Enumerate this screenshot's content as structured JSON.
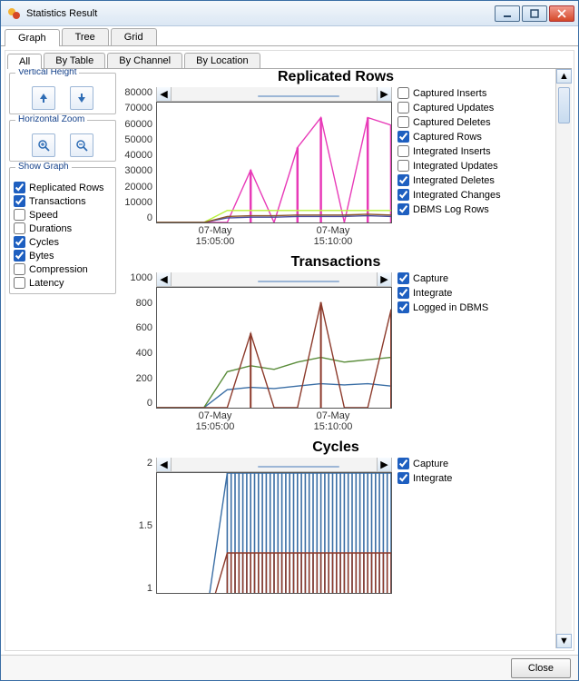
{
  "window": {
    "title": "Statistics Result"
  },
  "tabs": {
    "main": [
      "Graph",
      "Tree",
      "Grid"
    ],
    "sub": [
      "All",
      "By Table",
      "By Channel",
      "By Location"
    ]
  },
  "sidebar": {
    "vh_title": "Vertical Height",
    "hz_title": "Horizontal Zoom",
    "sg_title": "Show Graph",
    "show_items": [
      {
        "label": "Replicated Rows",
        "checked": true
      },
      {
        "label": "Transactions",
        "checked": true
      },
      {
        "label": "Speed",
        "checked": false
      },
      {
        "label": "Durations",
        "checked": false
      },
      {
        "label": "Cycles",
        "checked": true
      },
      {
        "label": "Bytes",
        "checked": true
      },
      {
        "label": "Compression",
        "checked": false
      },
      {
        "label": "Latency",
        "checked": false
      }
    ]
  },
  "charts": {
    "rr": {
      "title": "Replicated Rows",
      "legend": [
        {
          "label": "Captured Inserts",
          "checked": false
        },
        {
          "label": "Captured Updates",
          "checked": false
        },
        {
          "label": "Captured Deletes",
          "checked": false
        },
        {
          "label": "Captured Rows",
          "checked": true
        },
        {
          "label": "Integrated Inserts",
          "checked": false
        },
        {
          "label": "Integrated Updates",
          "checked": false
        },
        {
          "label": "Integrated Deletes",
          "checked": true
        },
        {
          "label": "Integrated Changes",
          "checked": true
        },
        {
          "label": "DBMS Log Rows",
          "checked": true
        }
      ],
      "xlabels": [
        {
          "l1": "07-May",
          "l2": "15:05:00"
        },
        {
          "l1": "07-May",
          "l2": "15:10:00"
        }
      ]
    },
    "tx": {
      "title": "Transactions",
      "legend": [
        {
          "label": "Capture",
          "checked": true
        },
        {
          "label": "Integrate",
          "checked": true
        },
        {
          "label": "Logged in DBMS",
          "checked": true
        }
      ],
      "xlabels": [
        {
          "l1": "07-May",
          "l2": "15:05:00"
        },
        {
          "l1": "07-May",
          "l2": "15:10:00"
        }
      ]
    },
    "cy": {
      "title": "Cycles",
      "legend": [
        {
          "label": "Capture",
          "checked": true
        },
        {
          "label": "Integrate",
          "checked": true
        }
      ]
    }
  },
  "footer": {
    "close": "Close"
  },
  "chart_data": [
    {
      "id": "rr",
      "type": "line",
      "title": "Replicated Rows",
      "ylabel": "",
      "ylim": [
        0,
        80000
      ],
      "yticks": [
        0,
        10000,
        20000,
        30000,
        40000,
        50000,
        60000,
        70000,
        80000
      ],
      "x": [
        "15:03",
        "15:04",
        "15:05",
        "15:06",
        "15:07",
        "15:08",
        "15:09",
        "15:10",
        "15:11",
        "15:12",
        "15:13"
      ],
      "series": [
        {
          "name": "Integrated Deletes",
          "color": "#e83ab8",
          "values": [
            0,
            0,
            0,
            0,
            35000,
            0,
            50000,
            70000,
            0,
            70000,
            65000
          ]
        },
        {
          "name": "Captured Rows",
          "color": "#b9f23a",
          "values": [
            0,
            0,
            0,
            8000,
            8000,
            8000,
            8000,
            8000,
            8000,
            8000,
            8000
          ]
        },
        {
          "name": "Integrated Changes",
          "color": "#4a4e9e",
          "values": [
            0,
            0,
            0,
            3000,
            3500,
            3500,
            4000,
            4000,
            4000,
            4500,
            4000
          ]
        },
        {
          "name": "DBMS Log Rows",
          "color": "#8c5a2b",
          "values": [
            0,
            0,
            0,
            4000,
            4500,
            4500,
            5000,
            5000,
            5000,
            5500,
            5000
          ]
        }
      ]
    },
    {
      "id": "tx",
      "type": "line",
      "title": "Transactions",
      "ylabel": "",
      "ylim": [
        0,
        1000
      ],
      "yticks": [
        0,
        200,
        400,
        600,
        800,
        1000
      ],
      "x": [
        "15:03",
        "15:04",
        "15:05",
        "15:06",
        "15:07",
        "15:08",
        "15:09",
        "15:10",
        "15:11",
        "15:12",
        "15:13"
      ],
      "series": [
        {
          "name": "Capture",
          "color": "#3a6ea5",
          "values": [
            0,
            0,
            0,
            150,
            170,
            160,
            180,
            200,
            190,
            200,
            180
          ]
        },
        {
          "name": "Integrate",
          "color": "#5a8c3a",
          "values": [
            0,
            0,
            0,
            300,
            350,
            320,
            380,
            420,
            380,
            400,
            420
          ]
        },
        {
          "name": "Logged in DBMS",
          "color": "#8c3a2b",
          "values": [
            0,
            0,
            0,
            0,
            620,
            0,
            0,
            880,
            0,
            0,
            820
          ]
        }
      ]
    },
    {
      "id": "cy",
      "type": "line",
      "title": "Cycles",
      "ylabel": "",
      "ylim": [
        0.5,
        2
      ],
      "yticks": [
        1,
        1.5,
        2
      ],
      "x": [
        "15:03",
        "15:04",
        "15:05",
        "15:06",
        "15:07",
        "15:08",
        "15:09",
        "15:10",
        "15:11",
        "15:12",
        "15:13"
      ],
      "series": [
        {
          "name": "Capture",
          "color": "#3a6ea5",
          "values": [
            0,
            0,
            0,
            2,
            2,
            2,
            2,
            2,
            2,
            2,
            2
          ]
        },
        {
          "name": "Integrate",
          "color": "#8c3a2b",
          "values": [
            0,
            0,
            0,
            1,
            1,
            1,
            1,
            1,
            1,
            1,
            1
          ]
        }
      ]
    }
  ]
}
